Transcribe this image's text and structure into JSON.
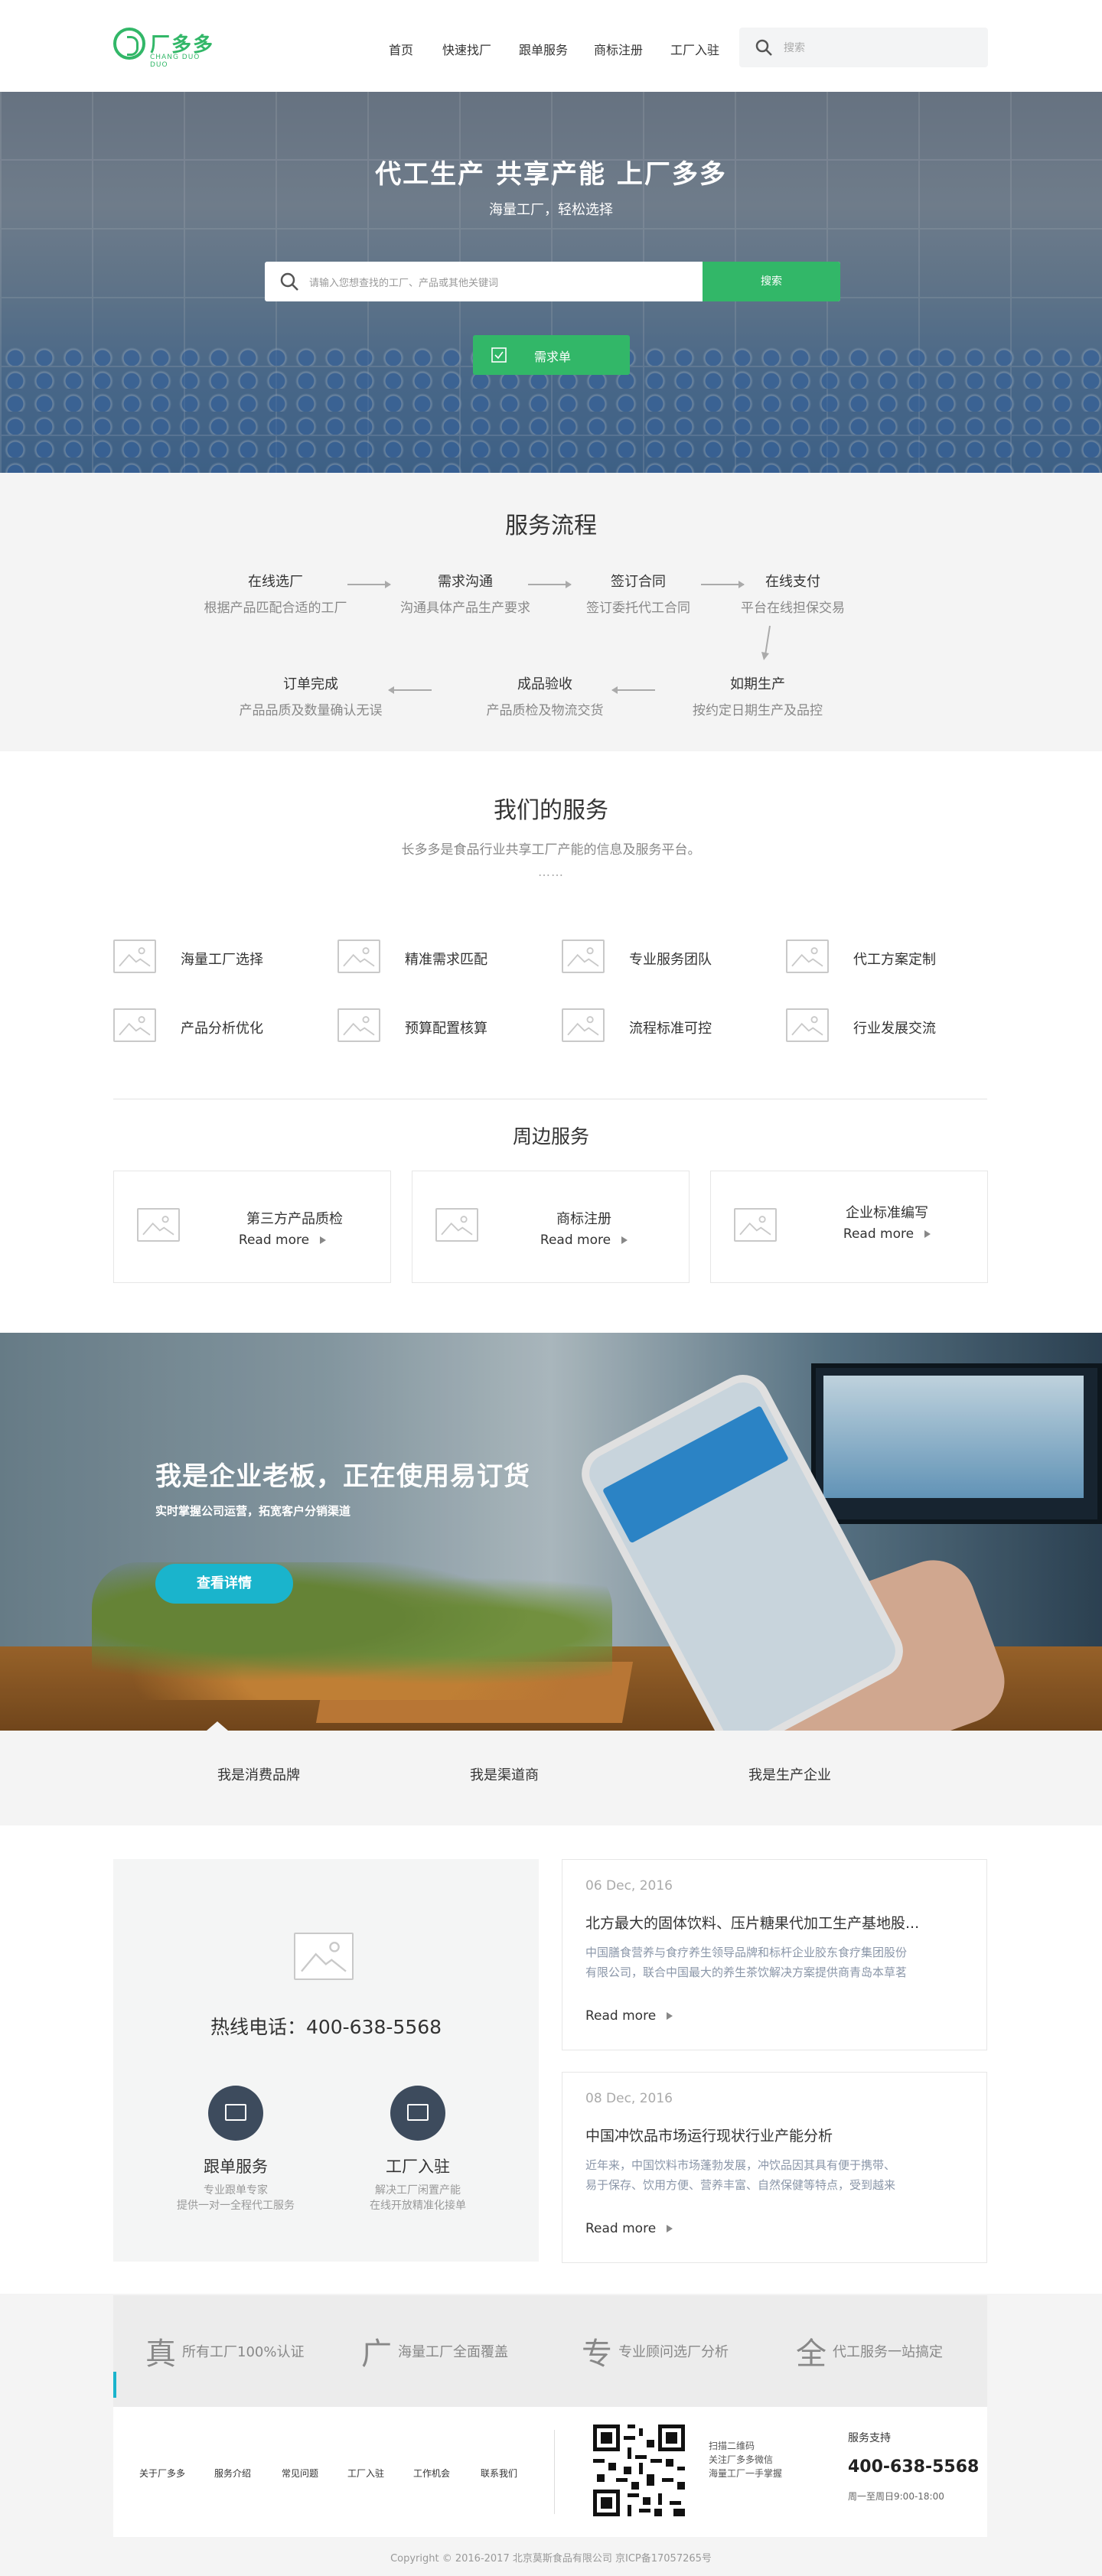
{
  "header": {
    "logo_text": "厂多多",
    "logo_sub": "CHANG DUO DUO",
    "nav": [
      "首页",
      "快速找厂",
      "跟单服务",
      "商标注册",
      "工厂入驻"
    ],
    "search_placeholder": "搜索"
  },
  "hero": {
    "title": "代工生产 共享产能 上厂多多",
    "subtitle": "海量工厂，轻松选择",
    "search_placeholder": "请输入您想查找的工厂、产品或其他关键词",
    "search_button": "搜索",
    "request_button": "需求单"
  },
  "process": {
    "title": "服务流程",
    "steps": [
      {
        "title": "在线选厂",
        "desc": "根据产品匹配合适的工厂"
      },
      {
        "title": "需求沟通",
        "desc": "沟通具体产品生产要求"
      },
      {
        "title": "签订合同",
        "desc": "签订委托代工合同"
      },
      {
        "title": "在线支付",
        "desc": "平台在线担保交易"
      },
      {
        "title": "如期生产",
        "desc": "按约定日期生产及品控"
      },
      {
        "title": "成品验收",
        "desc": "产品质检及物流交货"
      },
      {
        "title": "订单完成",
        "desc": "产品品质及数量确认无误"
      }
    ]
  },
  "services": {
    "title": "我们的服务",
    "subtitle": "长多多是食品行业共享工厂产能的信息及服务平台。",
    "dots": "……",
    "items": [
      "海量工厂选择",
      "精准需求匹配",
      "专业服务团队",
      "代工方案定制",
      "产品分析优化",
      "预算配置核算",
      "流程标准可控",
      "行业发展交流"
    ]
  },
  "peripheral": {
    "title": "周边服务",
    "items": [
      {
        "title": "第三方产品质检",
        "more": "Read more"
      },
      {
        "title": "商标注册",
        "more": "Read more"
      },
      {
        "title": "企业标准编写",
        "more": "Read more"
      }
    ]
  },
  "banner": {
    "title": "我是企业老板，正在使用易订货",
    "subtitle": "实时掌握公司运营，拓宽客户分销渠道",
    "button": "查看详情"
  },
  "roles": [
    "我是消费品牌",
    "我是渠道商",
    "我是生产企业"
  ],
  "contact": {
    "hotline": "热线电话：400-638-5568",
    "cards": [
      {
        "title": "跟单服务",
        "desc1": "专业跟单专家",
        "desc2": "提供一对一全程代工服务"
      },
      {
        "title": "工厂入驻",
        "desc1": "解决工厂闲置产能",
        "desc2": "在线开放精准化接单"
      }
    ]
  },
  "news": [
    {
      "date": "06 Dec, 2016",
      "title": "北方最大的固体饮料、压片糖果代加工生产基地股...",
      "excerpt1": "中国膳食营养与食疗养生领导品牌和标杆企业胶东食疗集团股份",
      "excerpt2": "有限公司，联合中国最大的养生茶饮解决方案提供商青岛本草茗",
      "more": "Read more"
    },
    {
      "date": "08 Dec, 2016",
      "title": "中国冲饮品市场运行现状行业产能分析",
      "excerpt1": "近年来，中国饮料市场蓬勃发展，冲饮品因其具有便于携带、",
      "excerpt2": "易于保存、饮用方便、营养丰富、自然保健等特点，受到越来",
      "more": "Read more"
    }
  ],
  "footer": {
    "features": [
      {
        "char": "真",
        "text": "所有工厂100%认证"
      },
      {
        "char": "广",
        "text": "海量工厂全面覆盖"
      },
      {
        "char": "专",
        "text": "专业顾问选厂分析"
      },
      {
        "char": "全",
        "text": "代工服务一站搞定"
      }
    ],
    "links": [
      "关于厂多多",
      "服务介绍",
      "常见问题",
      "工厂入驻",
      "工作机会",
      "联系我们"
    ],
    "qr_text": [
      "扫描二维码",
      "关注厂多多微信",
      "海量工厂一手掌握"
    ],
    "support_label": "服务支持",
    "support_phone": "400-638-5568",
    "support_hours": "周一至周日9:00-18:00",
    "copyright": "Copyright © 2016-2017 北京莫斯食品有限公司 京ICP备17057265号"
  },
  "colors": {
    "brand_green": "#32b768",
    "accent_cyan": "#1ab4cc",
    "dark_navy": "#3d4b5d"
  }
}
